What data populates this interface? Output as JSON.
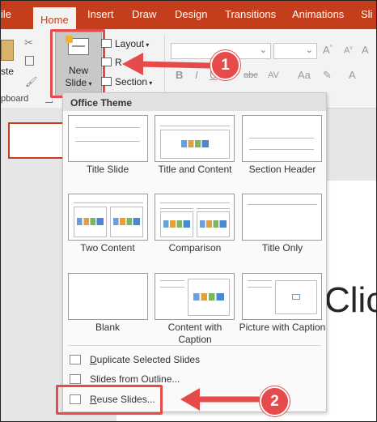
{
  "ribbon": {
    "tabs": [
      {
        "label": "ile"
      },
      {
        "label": "Home"
      },
      {
        "label": "Insert"
      },
      {
        "label": "Draw"
      },
      {
        "label": "Design"
      },
      {
        "label": "Transitions"
      },
      {
        "label": "Animations"
      },
      {
        "label": "Sli"
      }
    ],
    "paste_label": "ste",
    "clipboard_label": "pboard",
    "new_slide_line1": "New",
    "new_slide_line2": "Slide",
    "layout_label": "Layout",
    "reset_label": "R",
    "section_label": "Section",
    "font_bold": "B",
    "font_italic": "I",
    "font_strike": "abc"
  },
  "dropdown": {
    "header": "Office Theme",
    "layouts": [
      {
        "label": "Title Slide"
      },
      {
        "label": "Title and Content"
      },
      {
        "label": "Section Header"
      },
      {
        "label": "Two Content"
      },
      {
        "label": "Comparison"
      },
      {
        "label": "Title Only"
      },
      {
        "label": "Blank"
      },
      {
        "label": "Content with Caption"
      },
      {
        "label": "Picture with Caption"
      }
    ],
    "menu_items": [
      {
        "label": "Duplicate Selected Slides",
        "underline": "D",
        "rest": "uplicate Selected Slides"
      },
      {
        "label": "Slides from Outline...",
        "underline": "",
        "rest": "Slides from Outline..."
      },
      {
        "label": "Reuse Slides...",
        "underline": "R",
        "rest": "euse Slides..."
      }
    ]
  },
  "slide": {
    "title_fragment": "Clic"
  },
  "callouts": [
    {
      "number": "1"
    },
    {
      "number": "2"
    }
  ],
  "colors": {
    "accent": "#c43e1c",
    "callout": "#e54b4b"
  }
}
